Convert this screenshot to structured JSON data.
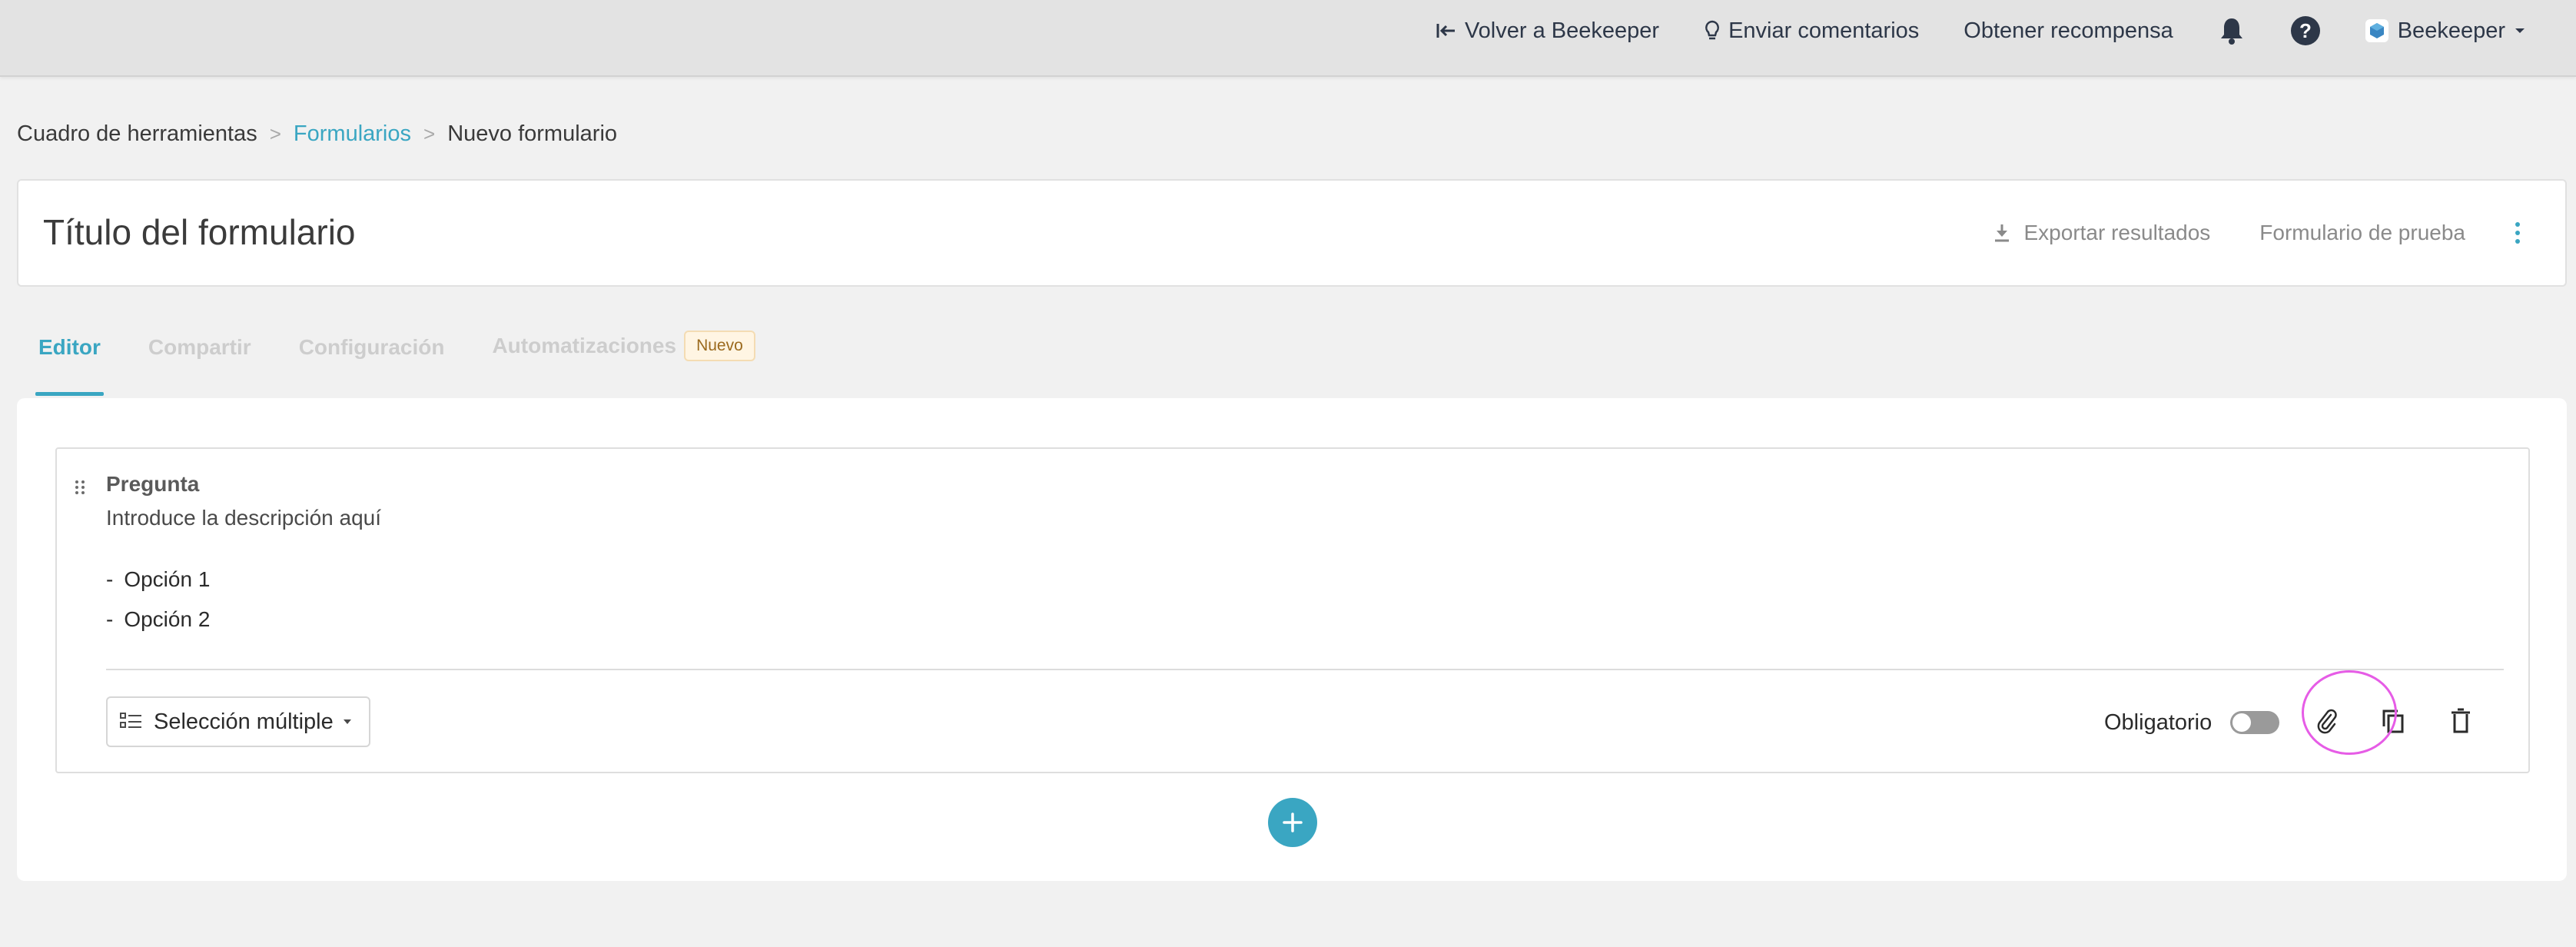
{
  "topbar": {
    "back_label": "Volver a Beekeeper",
    "feedback_label": "Enviar comentarios",
    "reward_label": "Obtener recompensa",
    "user_label": "Beekeeper"
  },
  "breadcrumb": {
    "items": [
      "Cuadro de herramientas",
      "Formularios",
      "Nuevo formulario"
    ],
    "separator": ">"
  },
  "form": {
    "title": "Título del formulario",
    "export_label": "Exportar resultados",
    "test_label": "Formulario de prueba"
  },
  "tabs": [
    {
      "label": "Editor",
      "active": true
    },
    {
      "label": "Compartir",
      "active": false
    },
    {
      "label": "Configuración",
      "active": false
    },
    {
      "label": "Automatizaciones",
      "active": false,
      "badge": "Nuevo"
    }
  ],
  "question": {
    "title": "Pregunta",
    "description": "Introduce la descripción aquí",
    "options": [
      "Opción 1",
      "Opción 2"
    ],
    "type_label": "Selección múltiple",
    "required_label": "Obligatorio",
    "required": false
  },
  "colors": {
    "accent": "#3aa6c2",
    "highlight": "#e65ce6",
    "badge_bg": "#fff5e3"
  },
  "icons": [
    "back-icon",
    "lightbulb-icon",
    "bell-icon",
    "help-icon",
    "beekeeper-logo-icon",
    "download-icon",
    "more-vertical-icon",
    "drag-handle-icon",
    "list-icon",
    "paperclip-icon",
    "copy-icon",
    "trash-icon",
    "plus-icon"
  ]
}
